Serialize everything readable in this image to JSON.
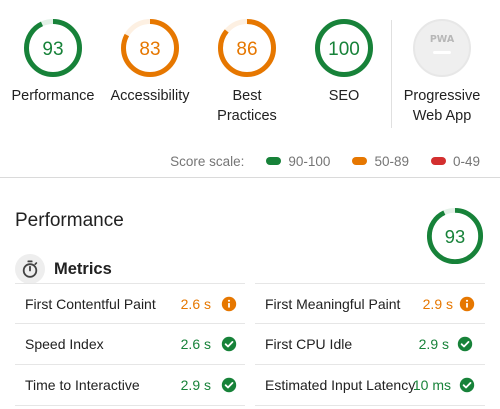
{
  "colors": {
    "pass": "#178239",
    "pass_track": "#e3f1e7",
    "average": "#e67700",
    "average_track": "#fdf0e2",
    "fail": "#d32f2f",
    "na_track": "#e7e7e7",
    "na_fill": "#efefef"
  },
  "categories": [
    {
      "score": "93",
      "score_value": 93,
      "status": "pass",
      "label": "Performance"
    },
    {
      "score": "83",
      "score_value": 83,
      "status": "average",
      "label": "Accessibility"
    },
    {
      "score": "86",
      "score_value": 86,
      "status": "average",
      "label": "Best Practices"
    },
    {
      "score": "100",
      "score_value": 100,
      "status": "pass",
      "label": "SEO"
    },
    {
      "score": "PWA",
      "status": "na",
      "label": "Progressive Web App",
      "icon": "pwa-badge-icon"
    }
  ],
  "score_scale": {
    "label": "Score scale:",
    "items": [
      {
        "range": "90-100",
        "status": "pass"
      },
      {
        "range": "50-89",
        "status": "average"
      },
      {
        "range": "0-49",
        "status": "fail"
      }
    ]
  },
  "section": {
    "title": "Performance",
    "score": "93",
    "score_value": 93,
    "status": "pass"
  },
  "metrics": {
    "title": "Metrics",
    "icon": "stopwatch-icon",
    "left": [
      {
        "name": "First Contentful Paint",
        "value": "2.6 s",
        "status": "average",
        "icon": "info-icon"
      },
      {
        "name": "Speed Index",
        "value": "2.6 s",
        "status": "pass",
        "icon": "check-icon"
      },
      {
        "name": "Time to Interactive",
        "value": "2.9 s",
        "status": "pass",
        "icon": "check-icon"
      }
    ],
    "right": [
      {
        "name": "First Meaningful Paint",
        "value": "2.9 s",
        "status": "average",
        "icon": "info-icon"
      },
      {
        "name": "First CPU Idle",
        "value": "2.9 s",
        "status": "pass",
        "icon": "check-icon"
      },
      {
        "name": "Estimated Input Latency",
        "value": "10 ms",
        "status": "pass",
        "icon": "check-icon"
      }
    ]
  }
}
